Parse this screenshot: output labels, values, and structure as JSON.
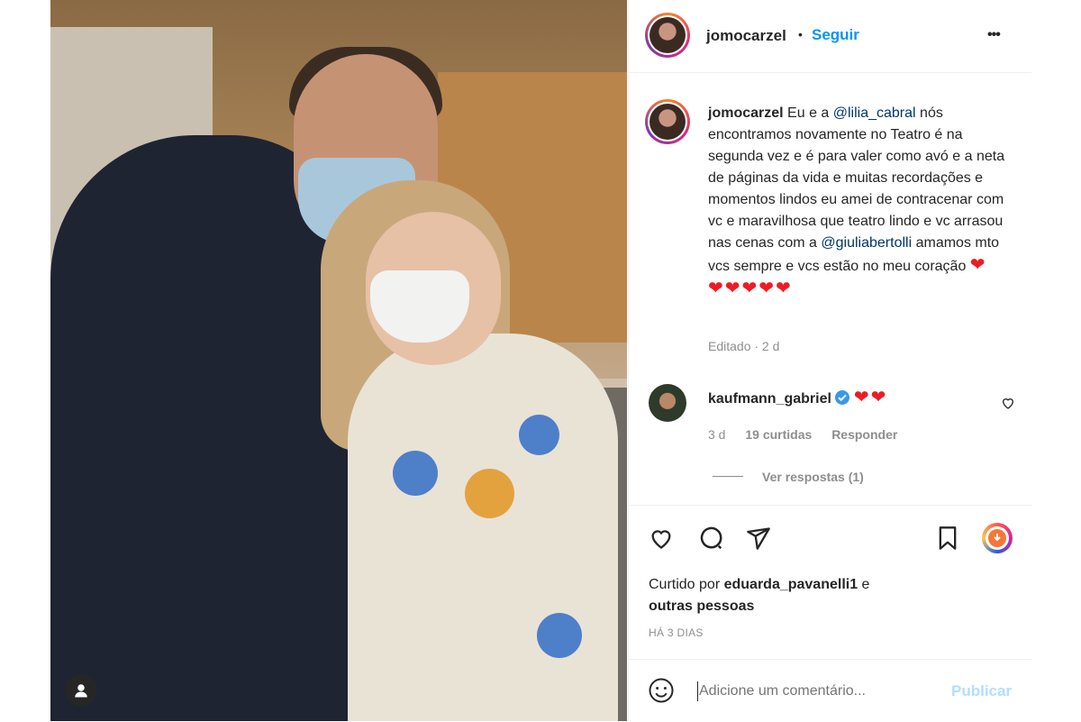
{
  "post": {
    "author": "jomocarzel",
    "follow_label": "Seguir",
    "separator": "•",
    "more_label": "•••"
  },
  "caption": {
    "author": "jomocarzel",
    "text_1": "Eu e a ",
    "mention_1": "@lilia_cabral",
    "text_2": " nós encontramos novamente no Teatro é na segunda vez e é para valer como avó e a neta de páginas da vida e muitas recordações e momentos lindos eu amei de contracenar com vc e maravilhosa que teatro lindo e vc arrasou nas cenas com a ",
    "mention_2": "@giuliabertolli",
    "text_3": " amamos mto vcs sempre e vcs estão no meu coração ",
    "hearts_inline": "❤",
    "hearts_row": "❤❤❤❤❤",
    "edited": "Editado · 2 d"
  },
  "comment": {
    "author": "kaufmann_gabriel",
    "text": "❤❤",
    "time": "3 d",
    "likes": "19 curtidas",
    "reply": "Responder",
    "view_replies": "Ver respostas (1)"
  },
  "likes": {
    "prefix": "Curtido por ",
    "user": "eduarda_pavanelli1",
    "suffix": " e",
    "line2": "outras pessoas"
  },
  "timestamp": "HÁ 3 DIAS",
  "add_comment": {
    "placeholder": "Adicione um comentário...",
    "publish": "Publicar"
  },
  "colors": {
    "accent": "#0095f6",
    "heart": "#ed1c24",
    "verified": "#3897f0"
  }
}
